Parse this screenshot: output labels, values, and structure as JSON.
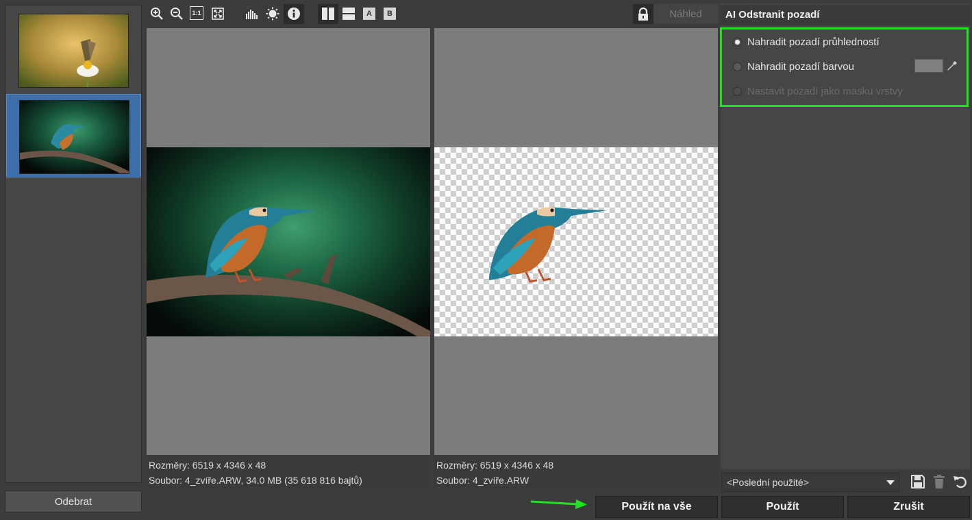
{
  "filmstrip": {
    "remove_label": "Odebrat"
  },
  "toolbar": {
    "zoom_100_label": "1:1",
    "view_a_label": "A",
    "view_b_label": "B",
    "preview_label": "Náhled"
  },
  "left_panel": {
    "dimensions": "Rozměry: 6519 x 4346 x 48",
    "file": "Soubor: 4_zvíře.ARW, 34.0 MB (35 618 816 bajtů)"
  },
  "right_panel": {
    "dimensions": "Rozměry: 6519 x 4346 x 48",
    "file": "Soubor: 4_zvíře.ARW"
  },
  "settings": {
    "title": "AI Odstranit pozadí",
    "options": [
      {
        "label": "Nahradit pozadí průhledností",
        "selected": true,
        "enabled": true
      },
      {
        "label": "Nahradit pozadí barvou",
        "selected": false,
        "enabled": true
      },
      {
        "label": "Nastavit pozadí jako masku vrstvy",
        "selected": false,
        "enabled": false
      }
    ],
    "replace_color": "#808080",
    "highlight_color": "#1ee61e",
    "presets_value": "<Poslední použité>"
  },
  "actions": {
    "apply_all_label": "Použít na vše",
    "apply_label": "Použít",
    "cancel_label": "Zrušit"
  }
}
